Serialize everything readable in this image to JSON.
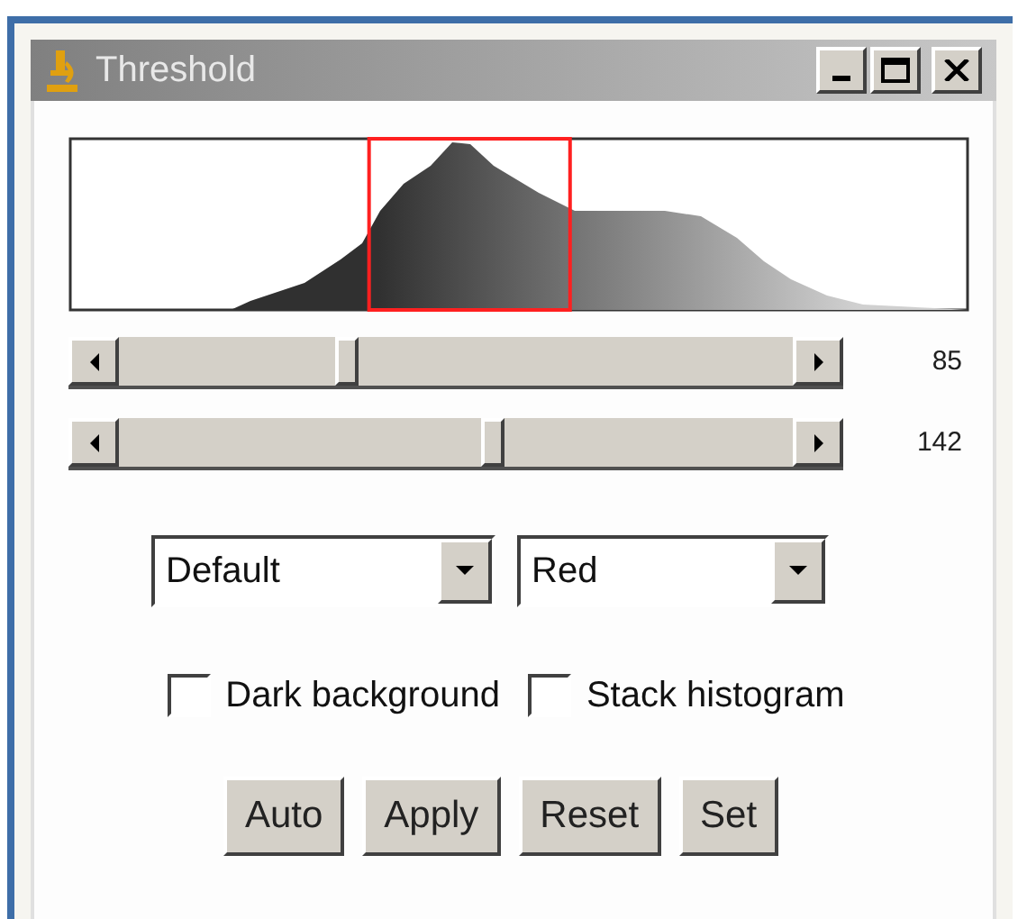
{
  "window": {
    "title": "Threshold"
  },
  "sliders": [
    {
      "reading": "85"
    },
    {
      "reading": "142"
    }
  ],
  "dropdowns": [
    {
      "value": "Default"
    },
    {
      "value": "Red"
    }
  ],
  "checkboxes": [
    {
      "label": "Dark background",
      "checked": false
    },
    {
      "label": "Stack histogram",
      "checked": false
    }
  ],
  "buttons": [
    "Auto",
    "Apply",
    "Reset",
    "Set"
  ]
}
